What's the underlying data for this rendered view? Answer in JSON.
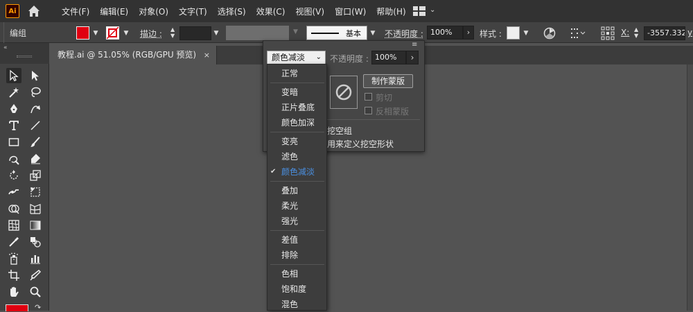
{
  "app": {
    "logo_text": "Ai"
  },
  "menu": [
    "文件(F)",
    "编辑(E)",
    "对象(O)",
    "文字(T)",
    "选择(S)",
    "效果(C)",
    "视图(V)",
    "窗口(W)",
    "帮助(H)"
  ],
  "control_bar": {
    "selection_label": "编组",
    "fill_color": "#e00010",
    "stroke_label": "描边 :",
    "stroke_profile": "基本",
    "opacity_label": "不透明度 :",
    "opacity_value": "100%",
    "style_label": "样式 :",
    "x_label": "X:",
    "x_value": "-3557.332",
    "y_label": "y"
  },
  "document_tab": {
    "title": "教程.ai @ 51.05% (RGB/GPU 预览)",
    "close": "×"
  },
  "transparency_panel": {
    "blend_mode": "颜色减淡",
    "opacity_label": "不透明度 :",
    "opacity_value": "100%",
    "make_mask": "制作蒙版",
    "clip": "剪切",
    "invert_mask": "反相蒙版",
    "knockout_group": "挖空组",
    "define_knockout": "版用来定义挖空形状"
  },
  "blend_modes": [
    {
      "label": "正常",
      "selected": false
    },
    {
      "label": "变暗",
      "selected": false
    },
    {
      "label": "正片叠底",
      "selected": false
    },
    {
      "label": "颜色加深",
      "selected": false
    },
    {
      "label": "变亮",
      "selected": false
    },
    {
      "label": "滤色",
      "selected": false
    },
    {
      "label": "颜色减淡",
      "selected": true
    },
    {
      "label": "叠加",
      "selected": false
    },
    {
      "label": "柔光",
      "selected": false
    },
    {
      "label": "强光",
      "selected": false
    },
    {
      "label": "差值",
      "selected": false
    },
    {
      "label": "排除",
      "selected": false
    },
    {
      "label": "色相",
      "selected": false
    },
    {
      "label": "饱和度",
      "selected": false
    },
    {
      "label": "混色",
      "selected": false
    }
  ],
  "colors": {
    "accent": "#4a90e2",
    "fill": "#e00010",
    "logo": "#ff9a00"
  }
}
